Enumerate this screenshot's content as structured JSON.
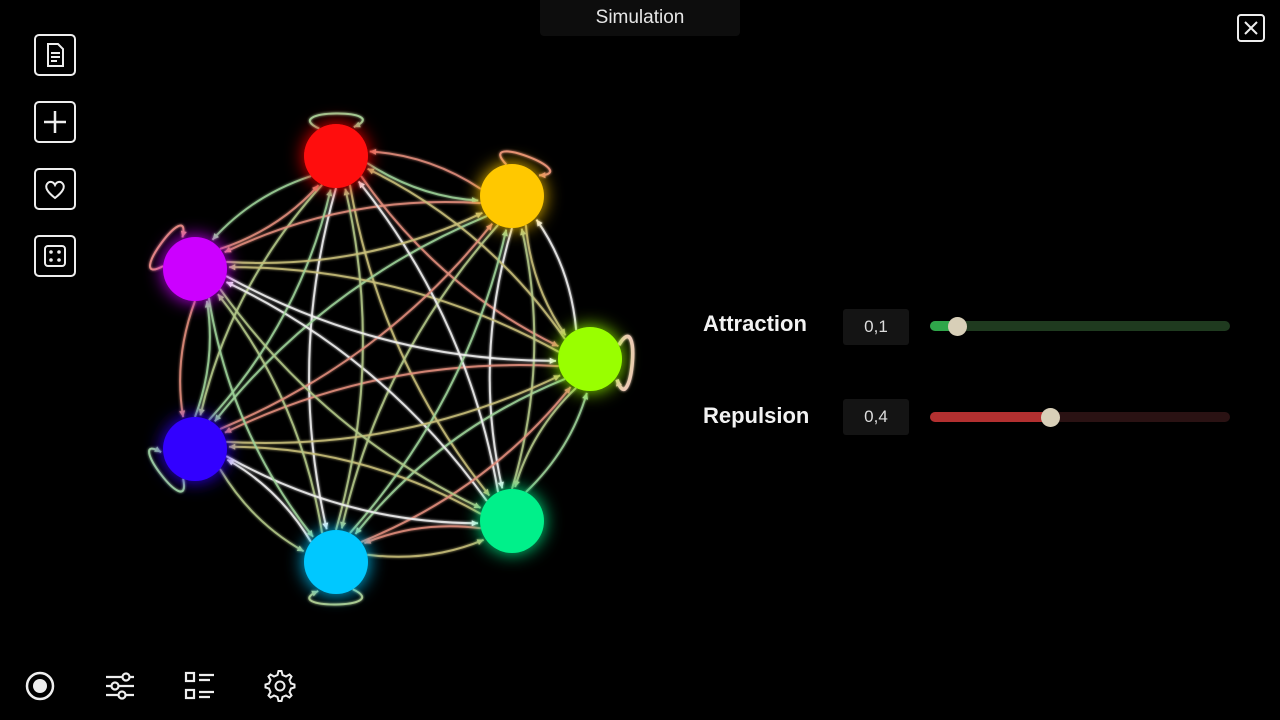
{
  "window": {
    "title": "Simulation"
  },
  "toolbar": {
    "items": [
      {
        "name": "document-icon"
      },
      {
        "name": "plus-icon"
      },
      {
        "name": "heart-icon"
      },
      {
        "name": "dice-icon"
      }
    ]
  },
  "bottom_bar": {
    "items": [
      {
        "name": "record-icon"
      },
      {
        "name": "sliders-icon"
      },
      {
        "name": "list-icon"
      },
      {
        "name": "gear-icon"
      }
    ]
  },
  "params": {
    "attraction": {
      "label": "Attraction",
      "value": "0,1",
      "fraction": 0.09,
      "track_color": "#1f3a1f",
      "fill_color": "#2fa64a"
    },
    "repulsion": {
      "label": "Repulsion",
      "value": "0,4",
      "fraction": 0.4,
      "track_color": "#2a1213",
      "fill_color": "#b33030"
    }
  },
  "graph": {
    "nodes": [
      {
        "id": "red",
        "color": "#ff1010"
      },
      {
        "id": "yellow",
        "color": "#ffc800"
      },
      {
        "id": "lime",
        "color": "#99ff00"
      },
      {
        "id": "green",
        "color": "#00f08a"
      },
      {
        "id": "cyan",
        "color": "#00c8ff"
      },
      {
        "id": "blue",
        "color": "#3300ff"
      },
      {
        "id": "magenta",
        "color": "#cc00ff"
      }
    ],
    "edge_colors": [
      "#9fd39a",
      "#e38e7c",
      "#c9c07a",
      "#f2f2f2",
      "#b4c98a"
    ]
  }
}
